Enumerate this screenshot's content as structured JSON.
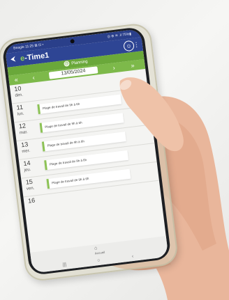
{
  "status_bar": {
    "time": "Beagle 11:25 ⊠ ⊡ •",
    "system": "◎ ⊕ ≋ .il 75%▮"
  },
  "app_bar": {
    "back_glyph": "⮜",
    "logo_e": "e",
    "logo_rest": "-Time1",
    "avatar_glyph": "☺",
    "menu_glyph": "⋮"
  },
  "planning": {
    "icon_glyph": "◷",
    "title": "Planning"
  },
  "date_nav": {
    "first": "«",
    "prev": "‹",
    "date": "13/05/2024",
    "next": "›",
    "last": "»"
  },
  "days": [
    {
      "number": "10",
      "name": "dim.",
      "shift": ""
    },
    {
      "number": "11",
      "name": "lun.",
      "shift": "Plage de travail de 9h à 6h"
    },
    {
      "number": "12",
      "name": "mar.",
      "shift": "Plage de travail de 9h à 6h"
    },
    {
      "number": "13",
      "name": "mer.",
      "shift": "Plage de travail de 9h à 6h"
    },
    {
      "number": "14",
      "name": "jeu.",
      "shift": "Plage de travail de 9h à 6h"
    },
    {
      "number": "15",
      "name": "ven.",
      "shift": "Plage de travail de 9h à 6h"
    },
    {
      "number": "16",
      "name": "",
      "shift": ""
    }
  ],
  "bottom_bar": {
    "home_label": "Accueil",
    "nav_recent": "|||",
    "nav_home": "○",
    "nav_back": "‹"
  },
  "colors": {
    "app_blue": "#2e4594",
    "accent_green": "#7db94a"
  }
}
